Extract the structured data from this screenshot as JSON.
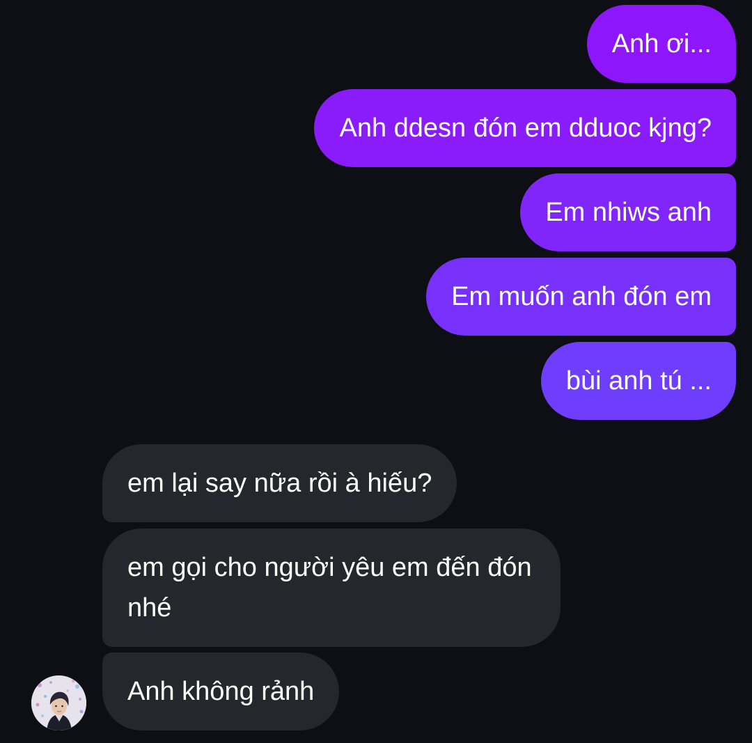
{
  "conversation": {
    "sent_messages": [
      {
        "text": "Anh ơi..."
      },
      {
        "text": "Anh ddesn đón em dduoc kjng?"
      },
      {
        "text": "Em nhiws anh"
      },
      {
        "text": "Em muốn anh đón em"
      },
      {
        "text": "bùi anh tú ..."
      }
    ],
    "received_messages": [
      {
        "text": "em lại say nữa rồi à hiếu?"
      },
      {
        "text": "em gọi cho người yêu em đến đón nhé"
      },
      {
        "text": "Anh không rảnh"
      }
    ],
    "contact": {
      "avatar_icon": "contact-avatar-photo"
    }
  },
  "colors": {
    "background": "#0e0f14",
    "sent_gradient_top": "#8d17fa",
    "sent_gradient_bottom": "#6f3dfc",
    "received_bubble": "#25272c",
    "text": "#ffffff"
  }
}
